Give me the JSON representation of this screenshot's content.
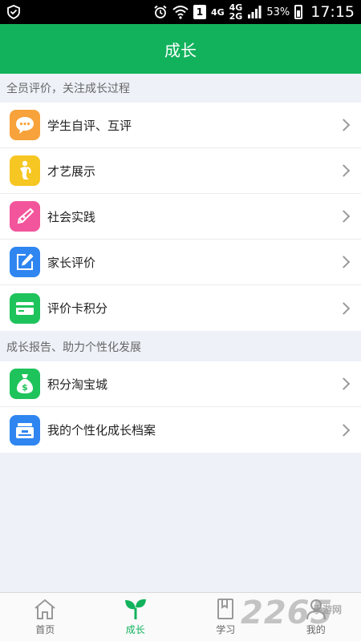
{
  "status_bar": {
    "sim_slot": "1",
    "network_top": "4G",
    "network_mid": "4G",
    "network_sub": "2G",
    "battery": "53%",
    "time": "17:15"
  },
  "header": {
    "title": "成长"
  },
  "sections": [
    {
      "title": "全员评价，关注成长过程",
      "items": [
        {
          "label": "学生自评、互评",
          "icon": "chat-bubble-icon",
          "color": "#f7a23b"
        },
        {
          "label": "才艺展示",
          "icon": "person-talent-icon",
          "color": "#f6c622"
        },
        {
          "label": "社会实践",
          "icon": "pen-icon",
          "color": "#f2559b"
        },
        {
          "label": "家长评价",
          "icon": "edit-icon",
          "color": "#2f86f0"
        },
        {
          "label": "评价卡积分",
          "icon": "card-icon",
          "color": "#1fc35b"
        }
      ]
    },
    {
      "title": "成长报告、助力个性化发展",
      "items": [
        {
          "label": "积分淘宝城",
          "icon": "money-bag-icon",
          "color": "#1fc35b"
        },
        {
          "label": "我的个性化成长档案",
          "icon": "archive-icon",
          "color": "#2f86f0"
        }
      ]
    }
  ],
  "tabs": [
    {
      "label": "首页",
      "icon": "home-icon"
    },
    {
      "label": "成长",
      "icon": "sprout-icon",
      "active": true
    },
    {
      "label": "学习",
      "icon": "book-icon"
    },
    {
      "label": "我的",
      "icon": "person-icon"
    }
  ],
  "watermark": {
    "number": "2265",
    "sub": "手游网"
  }
}
